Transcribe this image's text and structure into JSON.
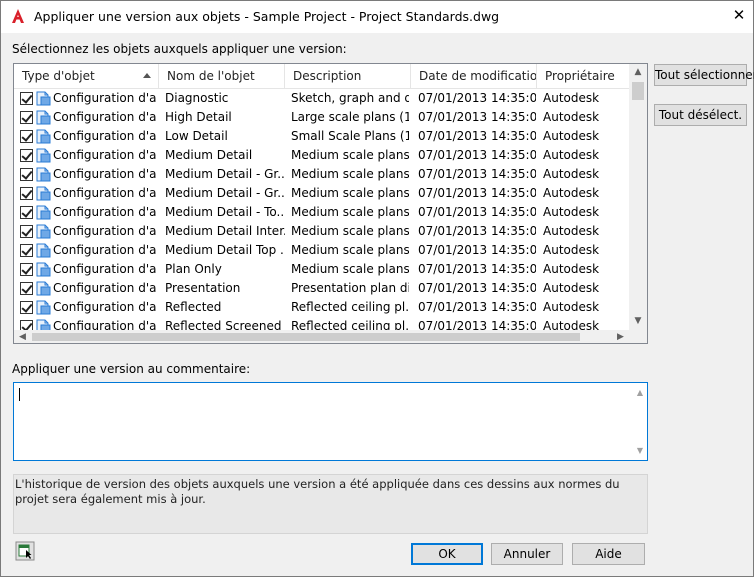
{
  "window": {
    "title": "Appliquer une version aux objets - Sample Project - Project Standards.dwg",
    "close_glyph": "✕",
    "icon": "autocad-icon"
  },
  "select_label": "Sélectionnez les objets auxquels appliquer une version:",
  "table": {
    "columns": [
      "Type d'objet",
      "Nom de l'objet",
      "Description",
      "Date de modificatio...",
      "Propriétaire"
    ],
    "sorted_column": "Type d'objet",
    "rows": [
      {
        "type": "Configuration d'a...",
        "name": "Diagnostic",
        "desc": "Sketch, graph and d...",
        "date": "07/01/2013 14:35:09",
        "owner": "Autodesk",
        "checked": true
      },
      {
        "type": "Configuration d'a...",
        "name": "High Detail",
        "desc": "Large scale plans (1...",
        "date": "07/01/2013 14:35:09",
        "owner": "Autodesk",
        "checked": true
      },
      {
        "type": "Configuration d'a...",
        "name": "Low Detail",
        "desc": "Small Scale Plans (1...",
        "date": "07/01/2013 14:35:09",
        "owner": "Autodesk",
        "checked": true
      },
      {
        "type": "Configuration d'a...",
        "name": "Medium Detail",
        "desc": "Medium scale plans...",
        "date": "07/01/2013 14:35:09",
        "owner": "Autodesk",
        "checked": true
      },
      {
        "type": "Configuration d'a...",
        "name": "Medium Detail - Gr...",
        "desc": "Medium scale plans...",
        "date": "07/01/2013 14:35:09",
        "owner": "Autodesk",
        "checked": true
      },
      {
        "type": "Configuration d'a...",
        "name": "Medium Detail - Gr...",
        "desc": "Medium scale plans...",
        "date": "07/01/2013 14:35:09",
        "owner": "Autodesk",
        "checked": true
      },
      {
        "type": "Configuration d'a...",
        "name": "Medium Detail - To...",
        "desc": "Medium scale plans...",
        "date": "07/01/2013 14:35:09",
        "owner": "Autodesk",
        "checked": true
      },
      {
        "type": "Configuration d'a...",
        "name": "Medium Detail Inter...",
        "desc": "Medium scale plans...",
        "date": "07/01/2013 14:35:09",
        "owner": "Autodesk",
        "checked": true
      },
      {
        "type": "Configuration d'a...",
        "name": "Medium Detail Top ...",
        "desc": "Medium scale plans...",
        "date": "07/01/2013 14:35:09",
        "owner": "Autodesk",
        "checked": true
      },
      {
        "type": "Configuration d'a...",
        "name": "Plan Only",
        "desc": "Medium scale plans...",
        "date": "07/01/2013 14:35:09",
        "owner": "Autodesk",
        "checked": true
      },
      {
        "type": "Configuration d'a...",
        "name": "Presentation",
        "desc": "Presentation plan di...",
        "date": "07/01/2013 14:35:09",
        "owner": "Autodesk",
        "checked": true
      },
      {
        "type": "Configuration d'a...",
        "name": "Reflected",
        "desc": "Reflected ceiling pl...",
        "date": "07/01/2013 14:35:09",
        "owner": "Autodesk",
        "checked": true
      },
      {
        "type": "Configuration d'a...",
        "name": "Reflected Screened",
        "desc": "Reflected ceiling pl...",
        "date": "07/01/2013 14:35:09",
        "owner": "Autodesk",
        "checked": true
      }
    ]
  },
  "buttons": {
    "select_all": "Tout sélectionner",
    "deselect_all": "Tout désélect.",
    "ok": "OK",
    "cancel": "Annuler",
    "help": "Aide"
  },
  "comment_label": "Appliquer une version au commentaire:",
  "comment_value": "",
  "info_text": "L'historique de version des objets auxquels une version a été appliquée dans ces dessins aux normes du projet sera également mis à jour.",
  "colors": {
    "accent": "#0078d7",
    "autocad_red": "#d9202a",
    "icon_blue": "#2a7bd4"
  }
}
